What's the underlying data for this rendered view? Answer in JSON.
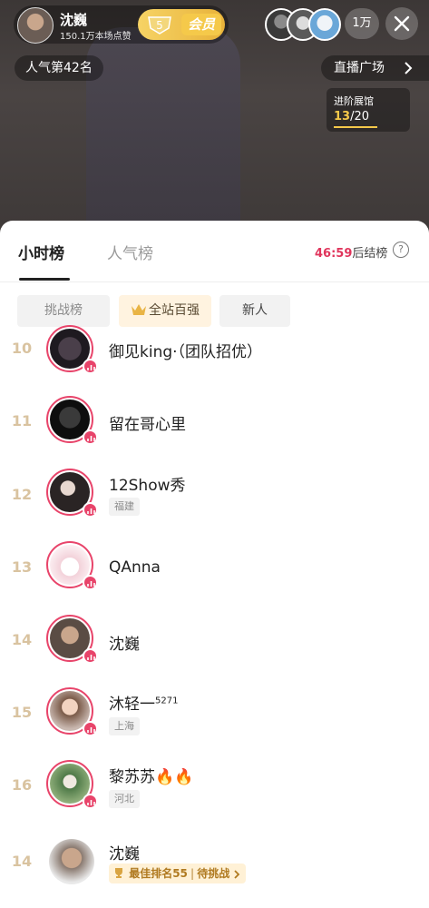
{
  "header": {
    "host_name": "沈巍",
    "host_likes": "150.1万本场点赞",
    "vip_level": "5",
    "vip_label": "会员",
    "viewer_count": "1万",
    "popularity_rank": "人气第42名",
    "plaza_label": "直播广场",
    "advance_title": "进阶展馆",
    "advance_current": "13",
    "advance_total": "/20",
    "icons": [
      "close-icon",
      "chevron-right-icon",
      "shield-badge-icon"
    ]
  },
  "tabs": {
    "hour": "小时榜",
    "popular": "人气榜",
    "countdown_time": "46:59",
    "countdown_suffix": "后结榜",
    "help": "?"
  },
  "chips": {
    "challenge": "挑战榜",
    "top100": "全站百强",
    "new": "新人"
  },
  "ranking": [
    {
      "rank": "10",
      "name": "御见king·（团队招优）",
      "tag": ""
    },
    {
      "rank": "11",
      "name": "留在哥心里",
      "tag": ""
    },
    {
      "rank": "12",
      "name": "12Show秀",
      "tag": "福建"
    },
    {
      "rank": "13",
      "name": "QAnna",
      "tag": ""
    },
    {
      "rank": "14",
      "name": "沈巍",
      "tag": ""
    },
    {
      "rank": "15",
      "name": "沐轻一",
      "name_sup": "5271",
      "tag": "上海"
    },
    {
      "rank": "16",
      "name": "黎苏苏🔥🔥",
      "tag": "河北"
    }
  ],
  "self": {
    "rank": "14",
    "name": "沈巍",
    "best_label": "最佳排名55",
    "challenge_label": "待挑战"
  },
  "colors": {
    "accent": "#e8446a",
    "rank_gold": "#d9c3a0",
    "vip_gold": "#f5c94a"
  }
}
